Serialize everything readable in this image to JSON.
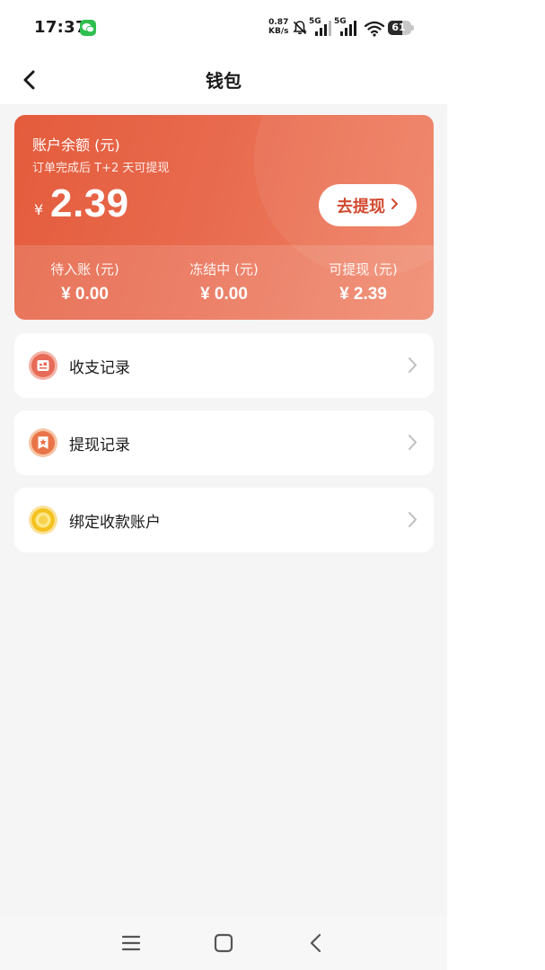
{
  "status_bar": {
    "time": "17:37",
    "net_speed_value": "0.87",
    "net_speed_unit": "KB/s",
    "signal1_label": "5G",
    "signal2_label": "5G",
    "battery_level": "61",
    "battery_fraction": 0.61,
    "icons": [
      "wechat-icon",
      "bell-muted-icon",
      "signal-icon",
      "signal-icon",
      "wifi-icon",
      "battery-icon"
    ]
  },
  "nav": {
    "back_icon": "chevron-left-icon",
    "title": "钱包"
  },
  "wallet": {
    "balance_label": "账户余额 (元)",
    "balance_hint": "订单完成后 T+2 天可提现",
    "currency_symbol": "¥",
    "balance_amount": "2.39",
    "withdraw_button": "去提现",
    "stats": [
      {
        "label": "待入账 (元)",
        "value": "¥ 0.00"
      },
      {
        "label": "冻结中 (元)",
        "value": "¥ 0.00"
      },
      {
        "label": "可提现 (元)",
        "value": "¥ 2.39"
      }
    ],
    "colors": {
      "card_start": "#e45c3c",
      "card_end": "#ef8467",
      "button_text": "#d2482e"
    }
  },
  "menu": {
    "items": [
      {
        "label": "收支记录",
        "icon": "ledger-icon"
      },
      {
        "label": "提现记录",
        "icon": "withdraw-record-icon"
      },
      {
        "label": "绑定收款账户",
        "icon": "coin-icon"
      }
    ]
  },
  "system_nav": {
    "icons": [
      "menu-icon",
      "home-icon",
      "back-icon"
    ]
  }
}
